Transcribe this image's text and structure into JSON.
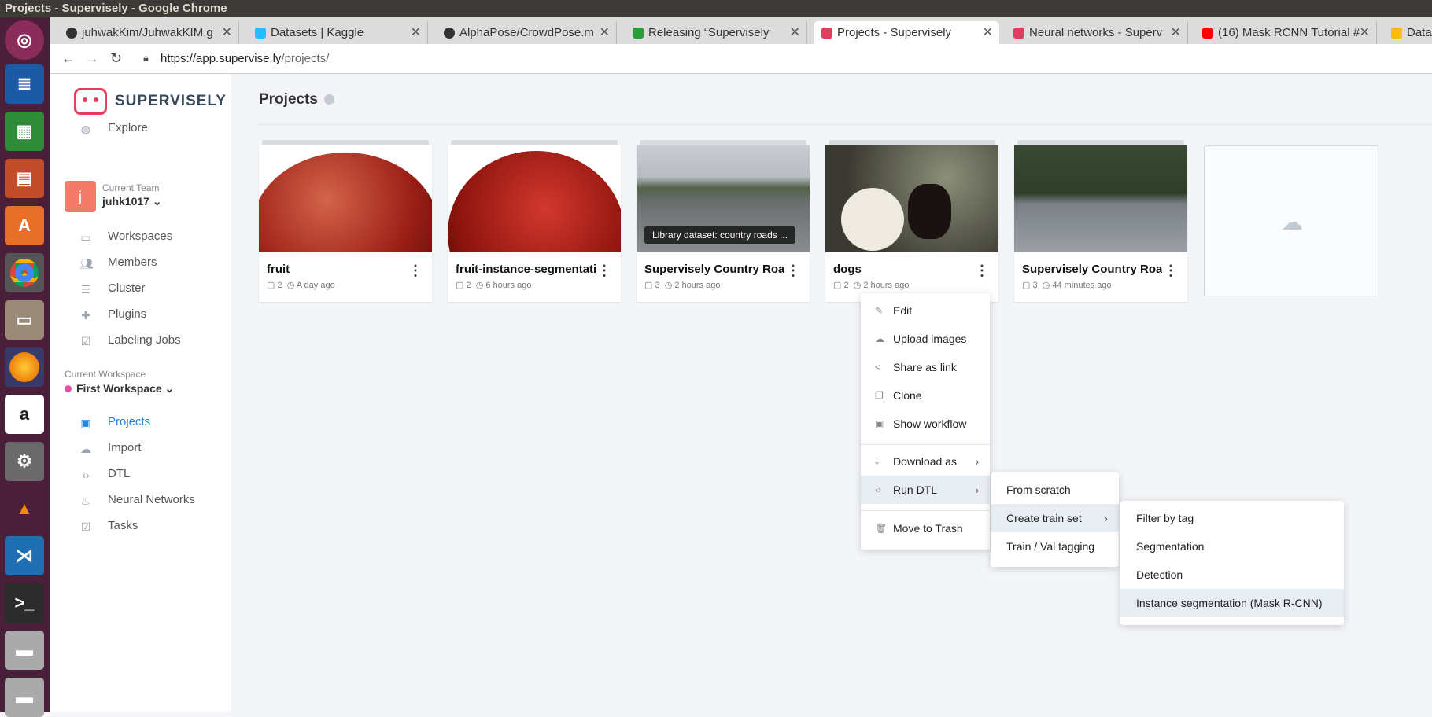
{
  "window": {
    "title": "Projects - Supervisely - Google Chrome"
  },
  "tabs": [
    {
      "label": "juhwakKim/JuhwakKIM.g",
      "fav": "#333"
    },
    {
      "label": "Datasets | Kaggle",
      "fav": "#20beff"
    },
    {
      "label": "AlphaPose/CrowdPose.m",
      "fav": "#333"
    },
    {
      "label": "Releasing “Supervisely",
      "fav": "#2a9d3a"
    },
    {
      "label": "Projects - Supervisely",
      "fav": "#e23d5f"
    },
    {
      "label": "Neural networks - Superv",
      "fav": "#e23d5f"
    },
    {
      "label": "(16) Mask RCNN Tutorial #",
      "fav": "#ff0000"
    },
    {
      "label": "Data",
      "fav": "#fbbc04"
    }
  ],
  "address": {
    "host": "https://app.supervise.ly",
    "path": "/projects/"
  },
  "sidebar": {
    "brand": "SUPERVISELY",
    "explore": "Explore",
    "team_label": "Current Team",
    "team_name": "juhk1017 ⌄",
    "team_initial": "j",
    "team_items": [
      "Workspaces",
      "Members",
      "Cluster",
      "Plugins",
      "Labeling Jobs"
    ],
    "workspace_label": "Current Workspace",
    "workspace_name": "First Workspace ⌄",
    "ws_items": [
      "Projects",
      "Import",
      "DTL",
      "Neural Networks",
      "Tasks"
    ]
  },
  "page": {
    "title": "Projects"
  },
  "projects": [
    {
      "name": "fruit",
      "count": "2",
      "time": "A day ago"
    },
    {
      "name": "fruit-instance-segmentation",
      "count": "2",
      "time": "6 hours ago"
    },
    {
      "name": "Supervisely Country Roads",
      "count": "3",
      "time": "2 hours ago",
      "caption": "Library dataset: country roads ..."
    },
    {
      "name": "dogs",
      "count": "2",
      "time": "2 hours ago"
    },
    {
      "name": "Supervisely Country Roads-",
      "count": "3",
      "time": "44 minutes ago"
    }
  ],
  "context_menu": {
    "items": [
      "Edit",
      "Upload images",
      "Share as link",
      "Clone",
      "Show workflow",
      "Download as",
      "Run DTL",
      "Move to Trash"
    ]
  },
  "submenu_dtl": {
    "items": [
      "From scratch",
      "Create train set",
      "Train / Val tagging"
    ]
  },
  "submenu_train": {
    "items": [
      "Filter by tag",
      "Segmentation",
      "Detection",
      "Instance segmentation (Mask R-CNN)"
    ]
  }
}
